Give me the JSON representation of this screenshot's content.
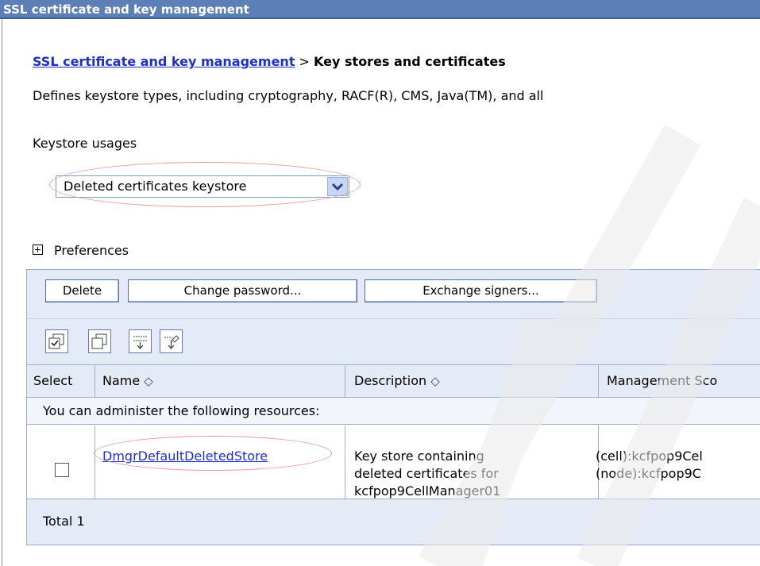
{
  "window": {
    "title": "SSL certificate and key management"
  },
  "breadcrumb": {
    "link": "SSL certificate and key management",
    "separator": " > ",
    "current": "Key stores and certificates"
  },
  "description": "Defines keystore types, including cryptography, RACF(R), CMS, Java(TM), and all",
  "keystore_usages": {
    "label": "Keystore usages",
    "selected": "Deleted certificates keystore"
  },
  "preferences": {
    "label": "Preferences"
  },
  "toolbar": {
    "delete": "Delete",
    "change_password": "Change password...",
    "exchange_signers": "Exchange signers..."
  },
  "icon_toolbar": [
    "select-all-icon",
    "deselect-all-icon",
    "show-filter-icon",
    "clear-filter-icon"
  ],
  "table": {
    "columns": {
      "select": "Select",
      "name": "Name",
      "description": "Description",
      "scope": "Management Sco"
    },
    "sort_glyph": "◇",
    "info_text": "You can administer the following resources:",
    "rows": [
      {
        "name": "DmgrDefaultDeletedStore",
        "description": [
          "Key store containing",
          "deleted certificates for",
          "kcfpop9CellManager01"
        ],
        "scope": [
          "(cell):kcfpop9Cel",
          "(node):kcfpop9C"
        ],
        "selected": false
      }
    ],
    "total": "Total 1"
  },
  "colors": {
    "title_bar": "#5d7fb8",
    "link": "#1e2ecf",
    "panel_bg": "#e5ebf6",
    "highlight_oval": "#e59aa2"
  }
}
